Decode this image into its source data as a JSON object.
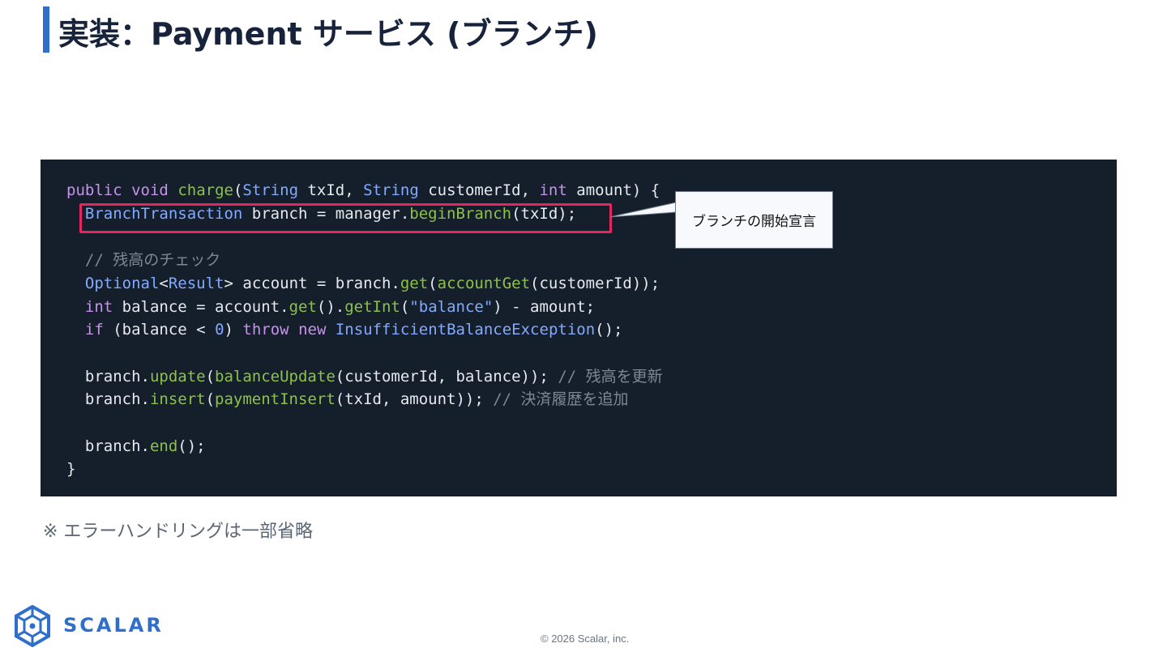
{
  "slide": {
    "title": "実装：Payment サービス (ブランチ)",
    "accent_color": "#2f6ec9",
    "highlight_color": "#e8255f",
    "callout_text": "ブランチの開始宣言",
    "note": "※ エラーハンドリングは一部省略",
    "logo_text": "SCALAR",
    "logo_icon": "scalar-hexagon-logo-icon",
    "footer": "© 2026 Scalar, inc."
  },
  "code": {
    "language": "java",
    "lines": [
      "public void charge(String txId, String customerId, int amount) {",
      "  BranchTransaction branch = manager.beginBranch(txId);",
      "",
      "  // 残高のチェック",
      "  Optional<Result> account = branch.get(accountGet(customerId));",
      "  int balance = account.get().getInt(\"balance\") - amount;",
      "  if (balance < 0) throw new InsufficientBalanceException();",
      "",
      "  branch.update(balanceUpdate(customerId, balance)); // 残高を更新",
      "  branch.insert(paymentInsert(txId, amount)); // 決済履歴を追加",
      "",
      "  branch.end();",
      "}"
    ]
  }
}
